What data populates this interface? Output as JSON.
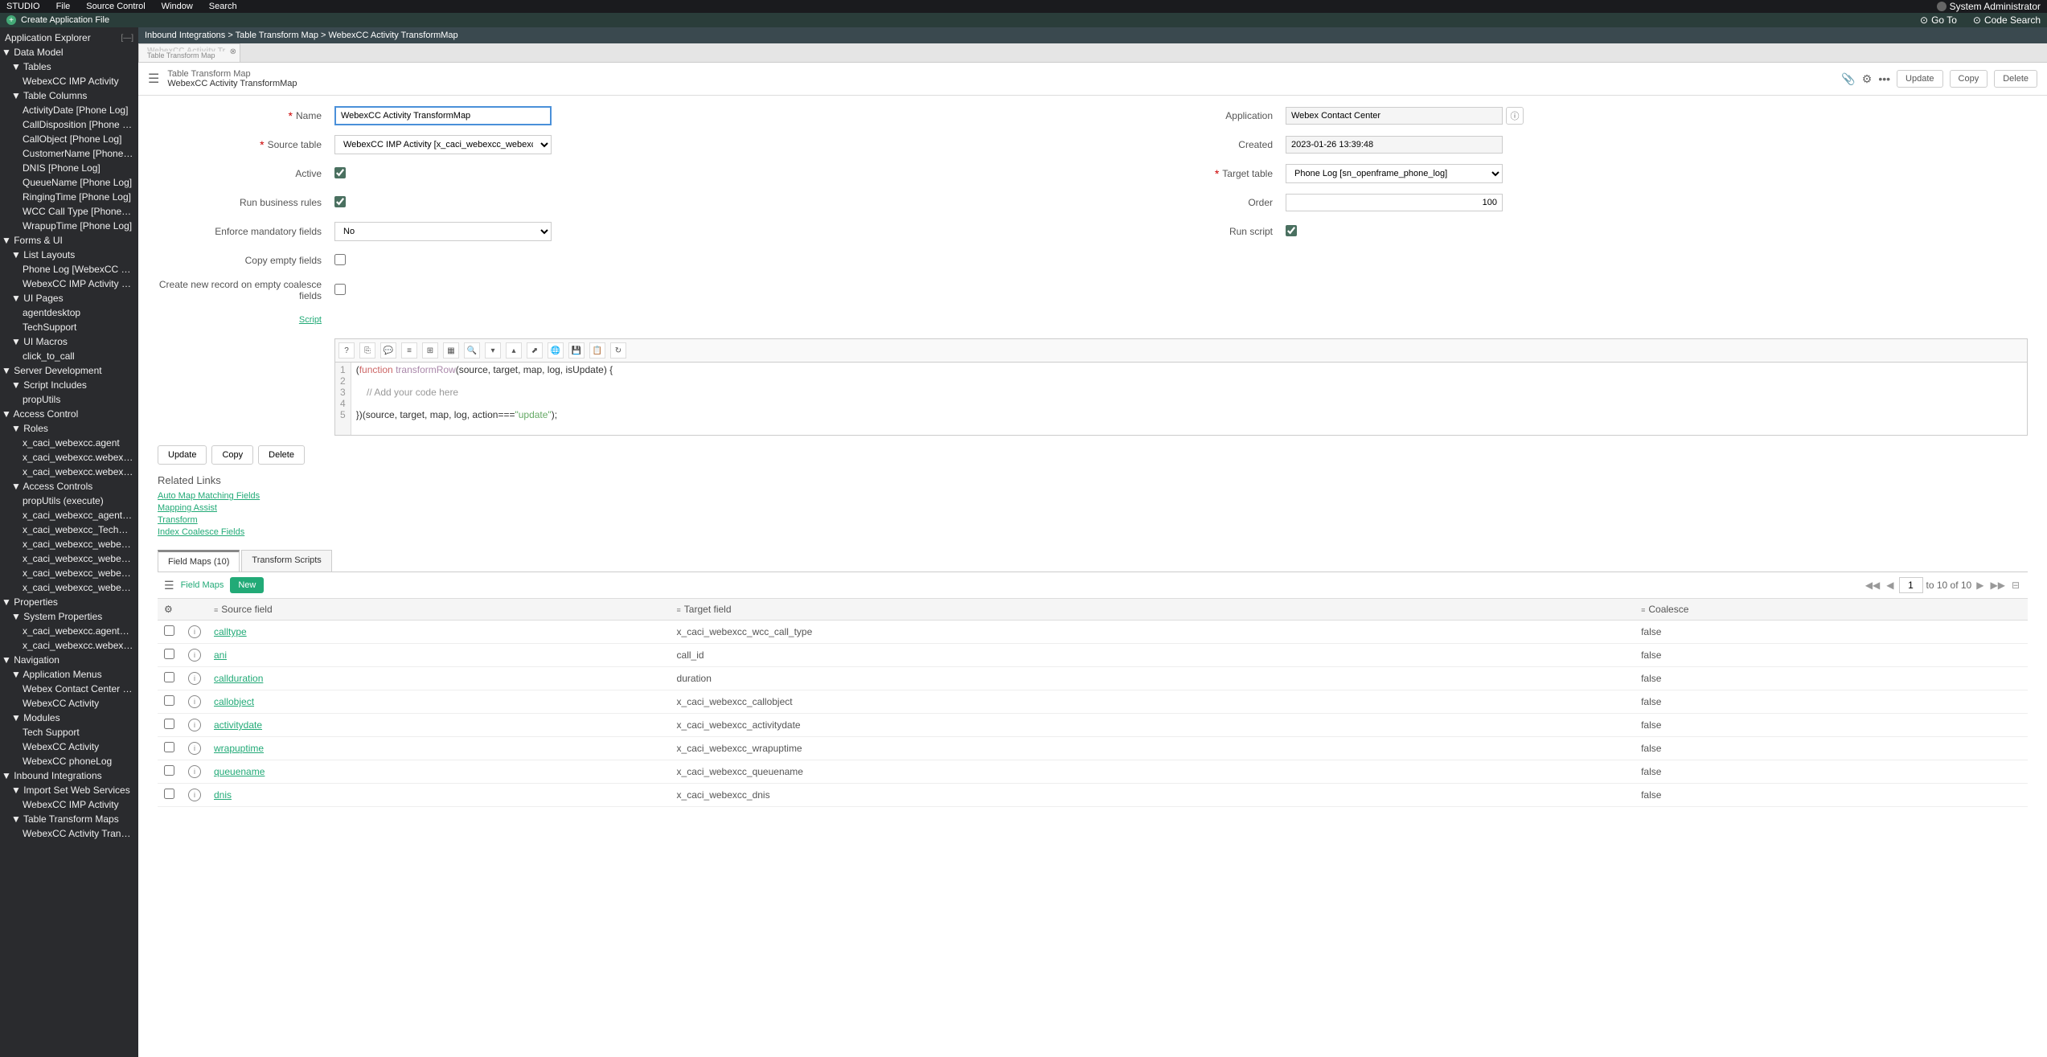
{
  "topbar": {
    "studio": "STUDIO",
    "file": "File",
    "source_control": "Source Control",
    "window": "Window",
    "search": "Search",
    "admin": "System Administrator"
  },
  "createbar": {
    "create": "Create Application File",
    "goto": "Go To",
    "codesearch": "Code Search"
  },
  "sidebar": {
    "header": "Application Explorer",
    "items": [
      {
        "l": 0,
        "t": "Data Model",
        "e": true
      },
      {
        "l": 1,
        "t": "Tables",
        "e": true
      },
      {
        "l": 2,
        "t": "WebexCC IMP Activity"
      },
      {
        "l": 1,
        "t": "Table Columns",
        "e": true
      },
      {
        "l": 2,
        "t": "ActivityDate [Phone Log]"
      },
      {
        "l": 2,
        "t": "CallDisposition [Phone Log]"
      },
      {
        "l": 2,
        "t": "CallObject [Phone Log]"
      },
      {
        "l": 2,
        "t": "CustomerName [Phone Log]"
      },
      {
        "l": 2,
        "t": "DNIS [Phone Log]"
      },
      {
        "l": 2,
        "t": "QueueName [Phone Log]"
      },
      {
        "l": 2,
        "t": "RingingTime [Phone Log]"
      },
      {
        "l": 2,
        "t": "WCC Call Type [Phone Log]"
      },
      {
        "l": 2,
        "t": "WrapupTime [Phone Log]"
      },
      {
        "l": 0,
        "t": "Forms & UI",
        "e": true
      },
      {
        "l": 1,
        "t": "List Layouts",
        "e": true
      },
      {
        "l": 2,
        "t": "Phone Log [WebexCC Phone Log]"
      },
      {
        "l": 2,
        "t": "WebexCC IMP Activity [Default view]"
      },
      {
        "l": 1,
        "t": "UI Pages",
        "e": true
      },
      {
        "l": 2,
        "t": "agentdesktop"
      },
      {
        "l": 2,
        "t": "TechSupport"
      },
      {
        "l": 1,
        "t": "UI Macros",
        "e": true
      },
      {
        "l": 2,
        "t": "click_to_call"
      },
      {
        "l": 0,
        "t": "Server Development",
        "e": true
      },
      {
        "l": 1,
        "t": "Script Includes",
        "e": true
      },
      {
        "l": 2,
        "t": "propUtils"
      },
      {
        "l": 0,
        "t": "Access Control",
        "e": true
      },
      {
        "l": 1,
        "t": "Roles",
        "e": true
      },
      {
        "l": 2,
        "t": "x_caci_webexcc.agent"
      },
      {
        "l": 2,
        "t": "x_caci_webexcc.webexcc_imp_activity_us"
      },
      {
        "l": 2,
        "t": "x_caci_webexcc.webex_contact_center"
      },
      {
        "l": 1,
        "t": "Access Controls",
        "e": true
      },
      {
        "l": 2,
        "t": "propUtils (execute)"
      },
      {
        "l": 2,
        "t": "x_caci_webexcc_agentdesktop (read)"
      },
      {
        "l": 2,
        "t": "x_caci_webexcc_TechSupport (read)"
      },
      {
        "l": 2,
        "t": "x_caci_webexcc_webexcc_imp_activity (re"
      },
      {
        "l": 2,
        "t": "x_caci_webexcc_webexcc_imp_activity (d"
      },
      {
        "l": 2,
        "t": "x_caci_webexcc_webexcc_imp_activity (cr"
      },
      {
        "l": 2,
        "t": "x_caci_webexcc_webexcc_imp_activity (w"
      },
      {
        "l": 0,
        "t": "Properties",
        "e": true
      },
      {
        "l": 1,
        "t": "System Properties",
        "e": true
      },
      {
        "l": 2,
        "t": "x_caci_webexcc.agentdesktop_url"
      },
      {
        "l": 2,
        "t": "x_caci_webexcc.webexccactivitytable"
      },
      {
        "l": 0,
        "t": "Navigation",
        "e": true
      },
      {
        "l": 1,
        "t": "Application Menus",
        "e": true
      },
      {
        "l": 2,
        "t": "Webex Contact Center for SNOW"
      },
      {
        "l": 2,
        "t": "WebexCC Activity"
      },
      {
        "l": 1,
        "t": "Modules",
        "e": true
      },
      {
        "l": 2,
        "t": "Tech Support"
      },
      {
        "l": 2,
        "t": "WebexCC Activity"
      },
      {
        "l": 2,
        "t": "WebexCC phoneLog"
      },
      {
        "l": 0,
        "t": "Inbound Integrations",
        "e": true
      },
      {
        "l": 1,
        "t": "Import Set Web Services",
        "e": true
      },
      {
        "l": 2,
        "t": "WebexCC IMP Activity"
      },
      {
        "l": 1,
        "t": "Table Transform Maps",
        "e": true
      },
      {
        "l": 2,
        "t": "WebexCC Activity TransformMap"
      }
    ]
  },
  "breadcrumb": "Inbound Integrations > Table Transform Map > WebexCC Activity TransformMap",
  "tab": {
    "title": "WebexCC Activity Tr...",
    "sub": "Table Transform Map"
  },
  "header": {
    "sub": "Table Transform Map",
    "main": "WebexCC Activity TransformMap",
    "update": "Update",
    "copy": "Copy",
    "delete": "Delete"
  },
  "form": {
    "name_label": "Name",
    "name_value": "WebexCC Activity TransformMap",
    "source_label": "Source table",
    "source_value": "WebexCC IMP Activity [x_caci_webexcc_webexcc_imp_activity]",
    "active_label": "Active",
    "run_rules_label": "Run business rules",
    "enforce_label": "Enforce mandatory fields",
    "enforce_value": "No",
    "copy_empty_label": "Copy empty fields",
    "create_coalesce_label": "Create new record on empty coalesce fields",
    "script_label": "Script",
    "application_label": "Application",
    "application_value": "Webex Contact Center",
    "created_label": "Created",
    "created_value": "2023-01-26 13:39:48",
    "target_label": "Target table",
    "target_value": "Phone Log [sn_openframe_phone_log]",
    "order_label": "Order",
    "order_value": "100",
    "runscript_label": "Run script"
  },
  "actions": {
    "update": "Update",
    "copy": "Copy",
    "delete": "Delete"
  },
  "related": {
    "title": "Related Links",
    "links": [
      "Auto Map Matching Fields",
      "Mapping Assist",
      "Transform",
      "Index Coalesce Fields"
    ]
  },
  "subtabs": {
    "tab1": "Field Maps (10)",
    "tab2": "Transform Scripts"
  },
  "list": {
    "title": "Field Maps",
    "new": "New",
    "page_cur": "1",
    "page_range": "to 10 of 10",
    "col_source": "Source field",
    "col_target": "Target field",
    "col_coalesce": "Coalesce",
    "rows": [
      {
        "source": "calltype",
        "target": "x_caci_webexcc_wcc_call_type",
        "coalesce": "false"
      },
      {
        "source": "ani",
        "target": "call_id",
        "coalesce": "false"
      },
      {
        "source": "callduration",
        "target": "duration",
        "coalesce": "false"
      },
      {
        "source": "callobject",
        "target": "x_caci_webexcc_callobject",
        "coalesce": "false"
      },
      {
        "source": "activitydate",
        "target": "x_caci_webexcc_activitydate",
        "coalesce": "false"
      },
      {
        "source": "wrapuptime",
        "target": "x_caci_webexcc_wrapuptime",
        "coalesce": "false"
      },
      {
        "source": "queuename",
        "target": "x_caci_webexcc_queuename",
        "coalesce": "false"
      },
      {
        "source": "dnis",
        "target": "x_caci_webexcc_dnis",
        "coalesce": "false"
      }
    ]
  }
}
